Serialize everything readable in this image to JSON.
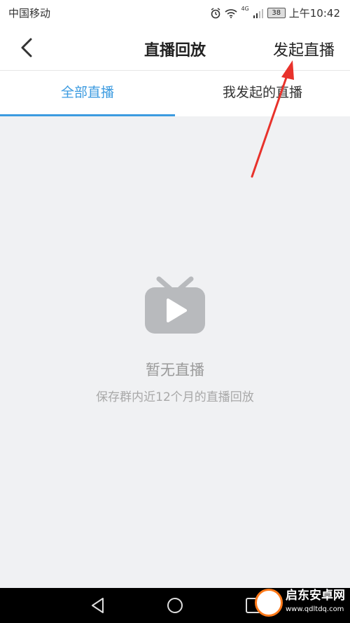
{
  "status_bar": {
    "carrier": "中国移动",
    "network": "4G",
    "battery": "38",
    "time": "上午10:42"
  },
  "nav": {
    "title": "直播回放",
    "action_label": "发起直播"
  },
  "tabs": [
    {
      "label": "全部直播",
      "active": true
    },
    {
      "label": "我发起的直播",
      "active": false
    }
  ],
  "empty_state": {
    "title": "暂无直播",
    "subtitle": "保存群内近12个月的直播回放"
  },
  "watermark": {
    "name": "启东安卓网",
    "url": "www.qdltdq.com"
  },
  "colors": {
    "accent": "#3c9be0",
    "annotation_arrow": "#e8322b",
    "icon_gray": "#b8babd"
  }
}
